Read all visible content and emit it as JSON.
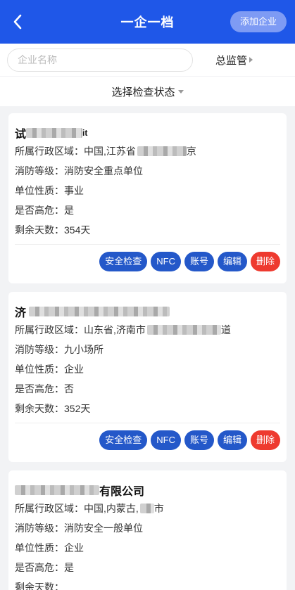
{
  "header": {
    "title": "一企一档",
    "add_label": "添加企业"
  },
  "search": {
    "placeholder": "企业名称",
    "supervisor": "总监管"
  },
  "filter": {
    "status": "选择检查状态"
  },
  "labels": {
    "region": "所属行政区域：",
    "fire_level": "消防等级：",
    "unit_nature": "单位性质：",
    "high_risk": "是否高危：",
    "days_left": "剩余天数："
  },
  "actions": {
    "check": "安全检查",
    "nfc": "NFC",
    "account": "账号",
    "edit": "编辑",
    "delete": "删除"
  },
  "cards": [
    {
      "name_prefix": "试",
      "name_suffix": "it",
      "region_visible": "中国,江苏省",
      "region_tail": "京",
      "fire_level": "消防安全重点单位",
      "unit_nature": "事业",
      "high_risk": "是",
      "days_left": "354天"
    },
    {
      "name_prefix": "济",
      "name_suffix": "",
      "region_visible": "山东省,济南市",
      "region_tail": "道",
      "fire_level": "九小场所",
      "unit_nature": "企业",
      "high_risk": "否",
      "days_left": "352天"
    },
    {
      "name_prefix": "",
      "name_suffix": "有限公司",
      "region_visible": "中国,内蒙古,",
      "region_tail": "市",
      "fire_level": "消防安全一般单位",
      "unit_nature": "企业",
      "high_risk": "是",
      "days_left": ""
    }
  ]
}
